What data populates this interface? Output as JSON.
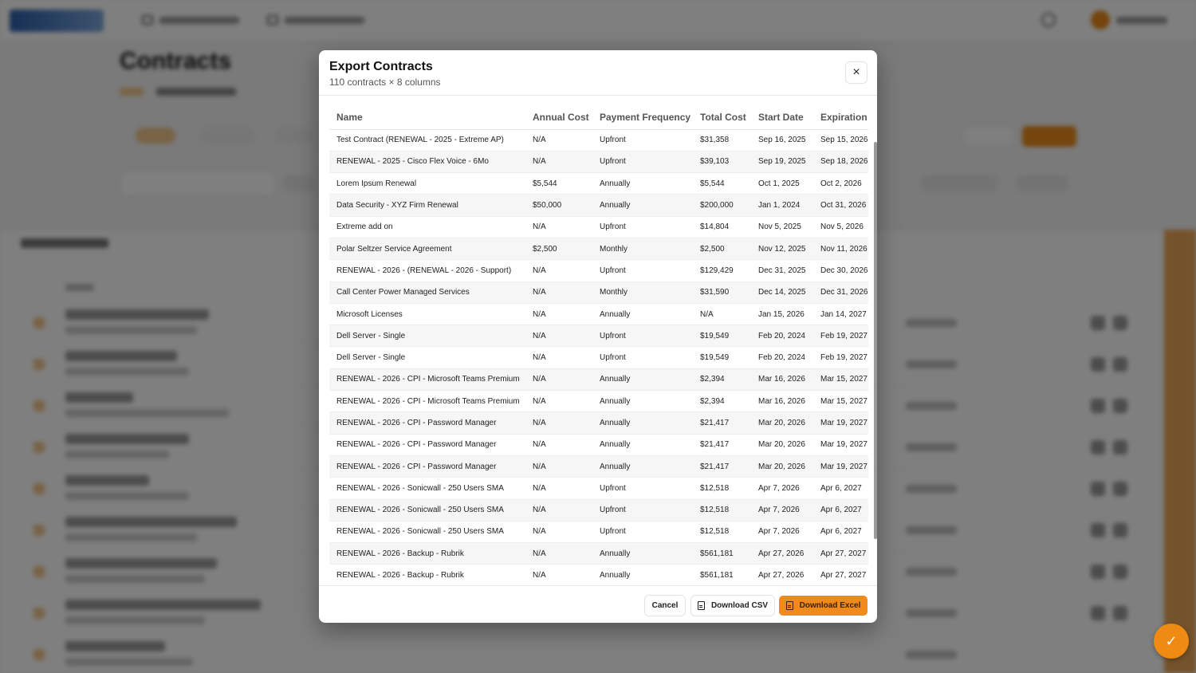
{
  "modal": {
    "title": "Export Contracts",
    "subtitle": "110 contracts × 8 columns",
    "close_icon": "×",
    "columns": [
      "Name",
      "Annual Cost",
      "Payment Frequency",
      "Total Cost",
      "Start Date",
      "Expiration"
    ],
    "rows": [
      [
        "Test Contract (RENEWAL - 2025 - Extreme AP)",
        "N/A",
        "Upfront",
        "$31,358",
        "Sep 16, 2025",
        "Sep 15, 2026"
      ],
      [
        "RENEWAL - 2025 - Cisco Flex Voice - 6Mo",
        "N/A",
        "Upfront",
        "$39,103",
        "Sep 19, 2025",
        "Sep 18, 2026"
      ],
      [
        "Lorem Ipsum Renewal",
        "$5,544",
        "Annually",
        "$5,544",
        "Oct 1, 2025",
        "Oct 2, 2026"
      ],
      [
        "Data Security - XYZ Firm Renewal",
        "$50,000",
        "Annually",
        "$200,000",
        "Jan 1, 2024",
        "Oct 31, 2026"
      ],
      [
        "Extreme add on",
        "N/A",
        "Upfront",
        "$14,804",
        "Nov 5, 2025",
        "Nov 5, 2026"
      ],
      [
        "Polar Seltzer Service Agreement",
        "$2,500",
        "Monthly",
        "$2,500",
        "Nov 12, 2025",
        "Nov 11, 2026"
      ],
      [
        "RENEWAL - 2026 - (RENEWAL - 2026 - Support)",
        "N/A",
        "Upfront",
        "$129,429",
        "Dec 31, 2025",
        "Dec 30, 2026"
      ],
      [
        "Call Center Power Managed Services",
        "N/A",
        "Monthly",
        "$31,590",
        "Dec 14, 2025",
        "Dec 31, 2026"
      ],
      [
        "Microsoft Licenses",
        "N/A",
        "Annually",
        "N/A",
        "Jan 15, 2026",
        "Jan 14, 2027"
      ],
      [
        "Dell Server - Single",
        "N/A",
        "Upfront",
        "$19,549",
        "Feb 20, 2024",
        "Feb 19, 2027"
      ],
      [
        "Dell Server - Single",
        "N/A",
        "Upfront",
        "$19,549",
        "Feb 20, 2024",
        "Feb 19, 2027"
      ],
      [
        "RENEWAL - 2026 - CPI - Microsoft Teams Premium",
        "N/A",
        "Annually",
        "$2,394",
        "Mar 16, 2026",
        "Mar 15, 2027"
      ],
      [
        "RENEWAL - 2026 - CPI - Microsoft Teams Premium",
        "N/A",
        "Annually",
        "$2,394",
        "Mar 16, 2026",
        "Mar 15, 2027"
      ],
      [
        "RENEWAL - 2026 - CPI - Password Manager",
        "N/A",
        "Annually",
        "$21,417",
        "Mar 20, 2026",
        "Mar 19, 2027"
      ],
      [
        "RENEWAL - 2026 - CPI - Password Manager",
        "N/A",
        "Annually",
        "$21,417",
        "Mar 20, 2026",
        "Mar 19, 2027"
      ],
      [
        "RENEWAL - 2026 - CPI - Password Manager",
        "N/A",
        "Annually",
        "$21,417",
        "Mar 20, 2026",
        "Mar 19, 2027"
      ],
      [
        "RENEWAL - 2026 - Sonicwall - 250 Users SMA",
        "N/A",
        "Upfront",
        "$12,518",
        "Apr 7, 2026",
        "Apr 6, 2027"
      ],
      [
        "RENEWAL - 2026 - Sonicwall - 250 Users SMA",
        "N/A",
        "Upfront",
        "$12,518",
        "Apr 7, 2026",
        "Apr 6, 2027"
      ],
      [
        "RENEWAL - 2026 - Sonicwall - 250 Users SMA",
        "N/A",
        "Upfront",
        "$12,518",
        "Apr 7, 2026",
        "Apr 6, 2027"
      ],
      [
        "RENEWAL - 2026 - Backup - Rubrik",
        "N/A",
        "Annually",
        "$561,181",
        "Apr 27, 2026",
        "Apr 27, 2027"
      ],
      [
        "RENEWAL - 2026 - Backup - Rubrik",
        "N/A",
        "Annually",
        "$561,181",
        "Apr 27, 2026",
        "Apr 27, 2027"
      ]
    ],
    "footer": {
      "cancel_label": "Cancel",
      "csv_label": "Download CSV",
      "excel_label": "Download Excel"
    }
  },
  "background": {
    "page_title": "Contracts"
  },
  "colors": {
    "accent": "#f08a1c",
    "overlay": "rgba(0,0,0,0.5)"
  },
  "icons": {
    "close": "close-icon",
    "csv": "file-icon",
    "excel": "file-icon",
    "fab": "chat-icon"
  }
}
